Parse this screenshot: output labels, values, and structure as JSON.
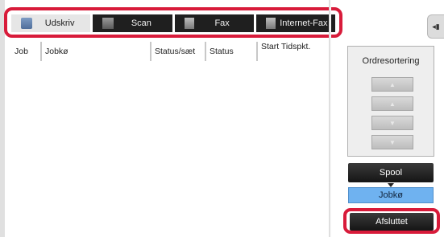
{
  "tabs": [
    {
      "label": "Udskriv",
      "icon": "printer-icon",
      "active": true
    },
    {
      "label": "Scan",
      "icon": "scanner-icon",
      "active": false
    },
    {
      "label": "Fax",
      "icon": "fax-icon",
      "active": false
    },
    {
      "label": "Internet-Fax",
      "icon": "internet-fax-icon",
      "active": false
    }
  ],
  "table": {
    "columns": [
      "Job",
      "Jobkø",
      "Status/sæt",
      "Status",
      "Start Tidspkt."
    ],
    "rows": []
  },
  "side": {
    "collapse_glyph": "◂▮",
    "sort_title": "Ordresortering",
    "sort_buttons": [
      "top-icon",
      "up-icon",
      "down-icon",
      "bottom-icon"
    ],
    "spool_label": "Spool",
    "jobq_label": "Jobkø",
    "done_label": "Afsluttet"
  },
  "colors": {
    "highlight": "#d81b3a",
    "selected": "#6fb2f0",
    "tab_dark": "#1f1f1f"
  }
}
